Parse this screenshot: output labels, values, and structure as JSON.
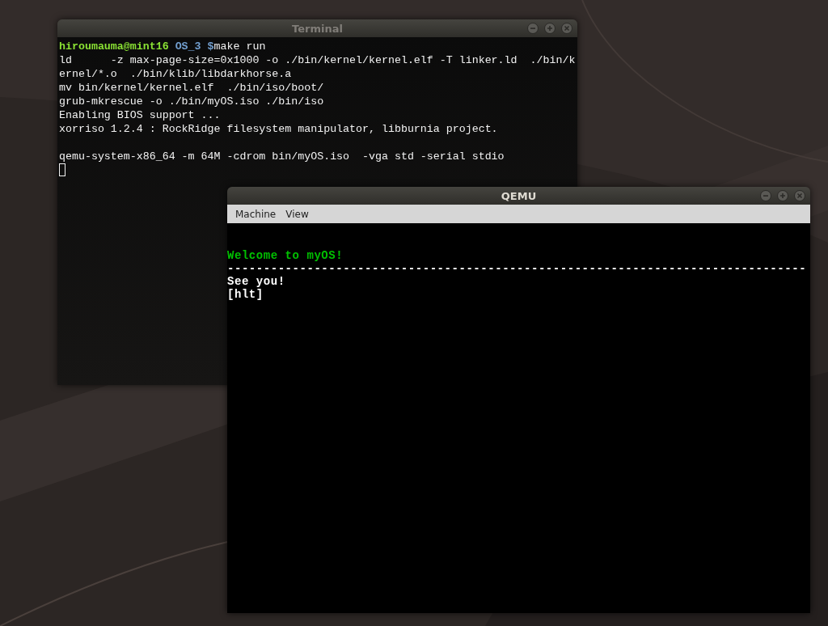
{
  "windows": [
    {
      "kind": "terminal",
      "title": "Terminal",
      "active": false,
      "prompt": {
        "user": "hiroumauma@mint16",
        "path": "OS_3",
        "symbol": "$",
        "command": "make run"
      },
      "blocks": [
        [
          "ld      -z max-page-size=0x1000 -o ./bin/kernel/kernel.elf -T linker.ld  ./bin/k",
          "ernel/*.o  ./bin/klib/libdarkhorse.a",
          "mv bin/kernel/kernel.elf  ./bin/iso/boot/",
          "grub-mkrescue -o ./bin/myOS.iso ./bin/iso",
          "Enabling BIOS support ...",
          "xorriso 1.2.4 : RockRidge filesystem manipulator, libburnia project."
        ],
        [
          "qemu-system-x86_64 -m 64M -cdrom bin/myOS.iso  -vga std -serial stdio"
        ]
      ]
    },
    {
      "kind": "vm",
      "title": "QEMU",
      "active": true,
      "menu": [
        "Machine",
        "View"
      ],
      "screen": [
        {
          "text": "Welcome to myOS!",
          "color": "#00c000"
        },
        {
          "text": "--------------------------------------------------------------------------------",
          "color": "#ffffff"
        },
        {
          "text": "See you!",
          "color": "#ffffff"
        },
        {
          "text": "[hlt]",
          "color": "#ffffff"
        }
      ]
    }
  ]
}
